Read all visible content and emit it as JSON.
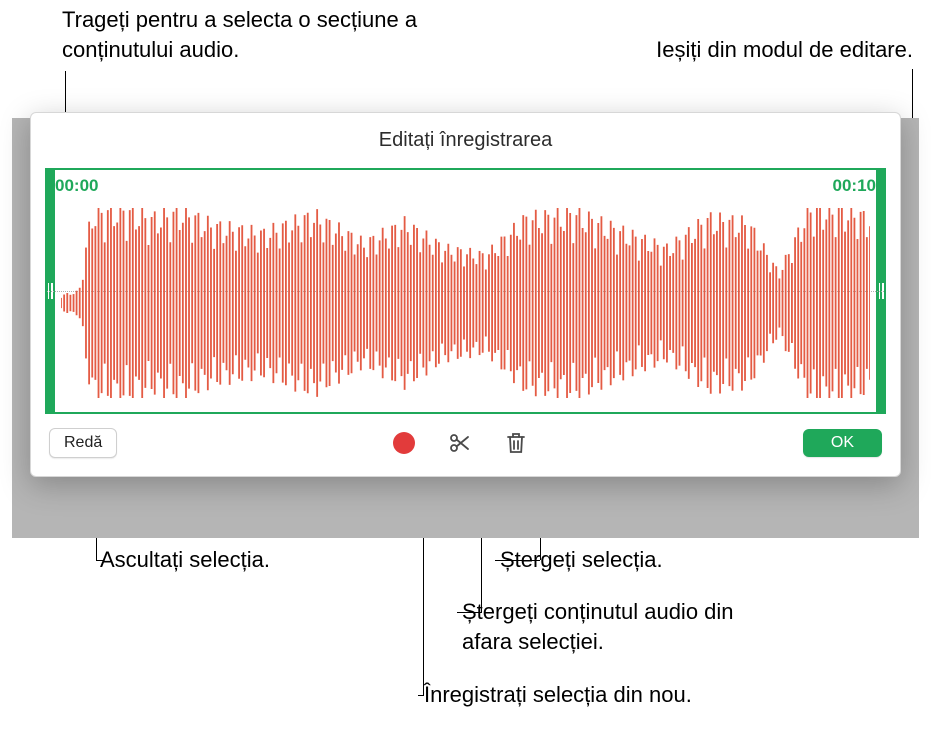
{
  "callouts": {
    "drag_select": "Trageți pentru a selecta o secțiune a conținutului audio.",
    "exit_edit": "Ieșiți din modul de editare.",
    "listen": "Ascultați selecția.",
    "delete_sel": "Ștergeți selecția.",
    "delete_outside": "Ștergeți conținutul audio din afara selecției.",
    "rerecord": "Înregistrați selecția din nou."
  },
  "panel": {
    "title": "Editați înregistrarea",
    "time_start": "00:00",
    "time_end": "00:10",
    "play_label": "Redă",
    "ok_label": "OK"
  },
  "icons": {
    "record": "record",
    "trim": "scissors",
    "delete": "trash"
  }
}
